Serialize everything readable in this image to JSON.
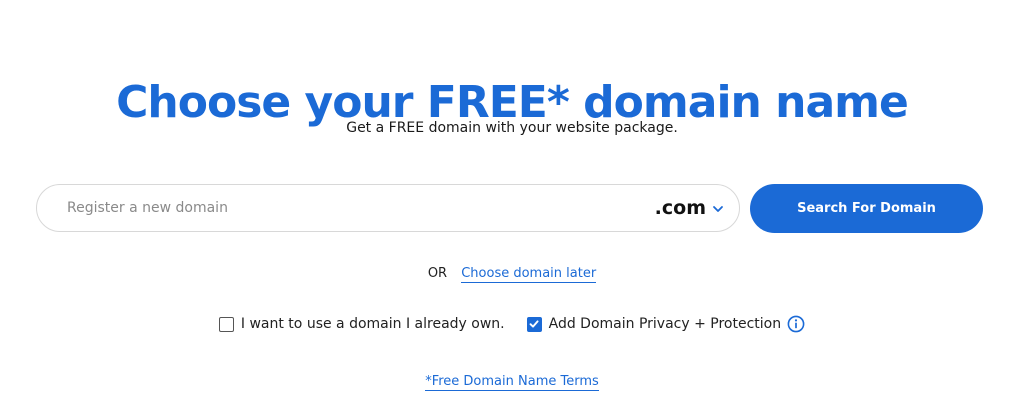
{
  "header": {
    "title": "Choose your FREE* domain name",
    "subtitle": "Get a FREE domain with your website package."
  },
  "search": {
    "placeholder": "Register a new domain",
    "value": "",
    "tld_selected": ".com",
    "button_label": "Search For Domain"
  },
  "alternate": {
    "or_label": "OR",
    "choose_later_link": "Choose domain later"
  },
  "options": {
    "own_domain": {
      "label": "I want to use a domain I already own.",
      "checked": false
    },
    "privacy": {
      "label": "Add Domain Privacy + Protection",
      "checked": true
    }
  },
  "footer": {
    "terms_link": "*Free Domain Name Terms"
  },
  "colors": {
    "brand_blue": "#1b6ad6",
    "text_dark": "#222222",
    "placeholder_gray": "#8a8a8a",
    "border_gray": "#d8d8d8"
  },
  "icons": {
    "tld_dropdown": "chevron-down-icon",
    "privacy_info": "info-icon",
    "checkbox_check": "check-icon"
  }
}
